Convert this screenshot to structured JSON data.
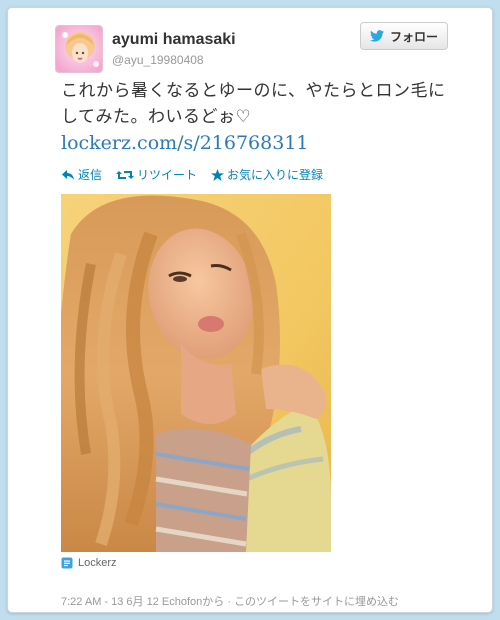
{
  "user": {
    "name": "ayumi hamasaki",
    "handle": "@ayu_19980408"
  },
  "follow_button": {
    "label": "フォロー",
    "icon": "twitter-bird-icon"
  },
  "tweet": {
    "text": "これから暑くなるとゆーのに、やたらとロン毛にしてみた。わいるどぉ♡",
    "link": "lockerz.com/s/216768311"
  },
  "actions": {
    "reply": "返信",
    "retweet": "リツイート",
    "favorite": "お気に入りに登録"
  },
  "media": {
    "source_label": "Lockerz",
    "source_icon": "lockerz-icon"
  },
  "meta": {
    "timestamp": "7:22 AM - 13 6月 12",
    "via": "Echofonから",
    "separator": " · ",
    "embed": "このツイートをサイトに埋め込む"
  },
  "colors": {
    "background": "#c0deed",
    "link": "#2a7ab8",
    "action": "#0084b4",
    "twitter_blue": "#2aa9e0"
  }
}
